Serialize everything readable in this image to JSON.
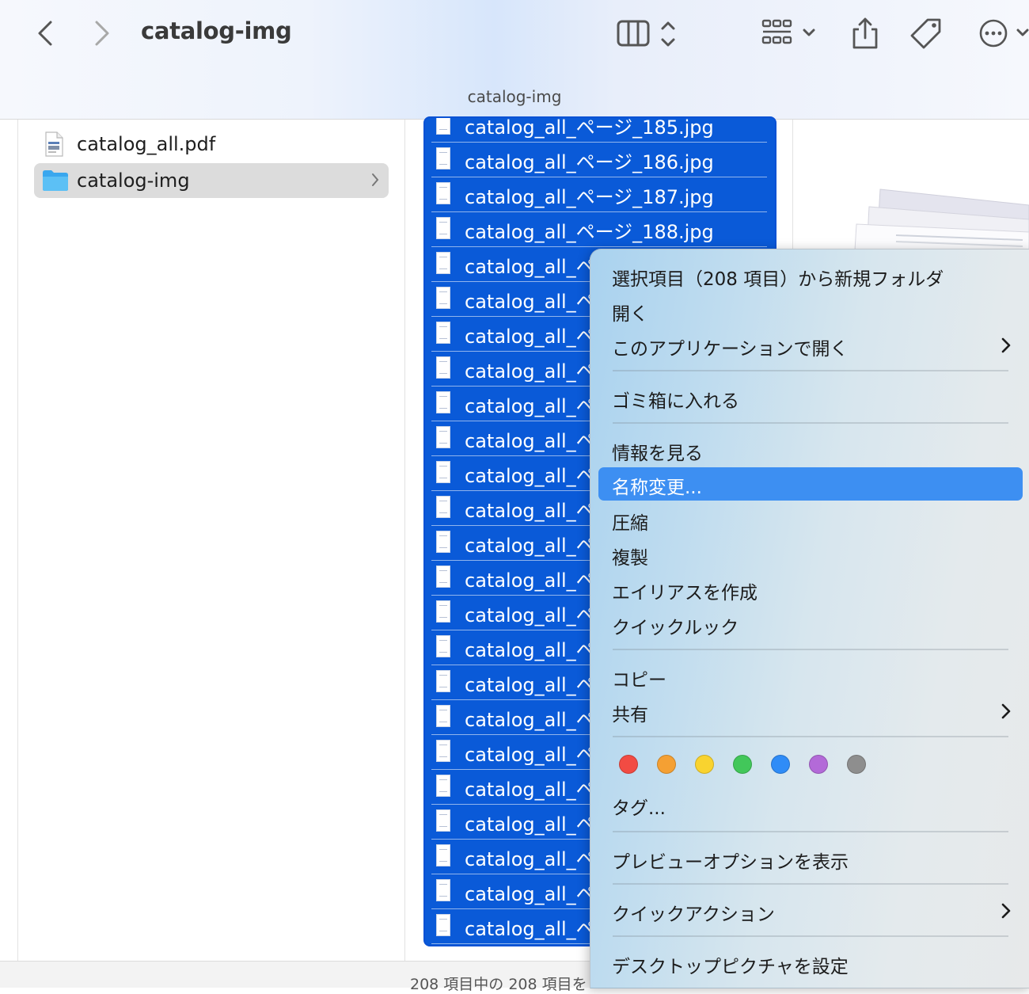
{
  "window": {
    "title": "catalog-img",
    "path_label": "catalog-img"
  },
  "toolbar": {
    "back_icon": "chevron-left-icon",
    "forward_icon": "chevron-right-icon",
    "view_icon": "column-view-icon",
    "group_icon": "grid-view-icon",
    "share_icon": "share-icon",
    "tag_icon": "tag-icon",
    "more_icon": "ellipsis-circle-icon"
  },
  "sidebar_column": {
    "items": [
      {
        "label": "catalog_all.pdf",
        "icon": "pdf-file-icon",
        "selected": false
      },
      {
        "label": "catalog-img",
        "icon": "folder-icon",
        "selected": true
      }
    ]
  },
  "file_column": {
    "files": [
      "catalog_all_ページ_185.jpg",
      "catalog_all_ページ_186.jpg",
      "catalog_all_ページ_187.jpg",
      "catalog_all_ページ_188.jpg",
      "catalog_all_ペ",
      "catalog_all_ペ",
      "catalog_all_ペ",
      "catalog_all_ペ",
      "catalog_all_ペ",
      "catalog_all_ペ",
      "catalog_all_ペ",
      "catalog_all_ペ",
      "catalog_all_ペ",
      "catalog_all_ペ",
      "catalog_all_ペ",
      "catalog_all_ペ",
      "catalog_all_ペ",
      "catalog_all_ペ",
      "catalog_all_ペ",
      "catalog_all_ペ",
      "catalog_all_ペ",
      "catalog_all_ペ",
      "catalog_all_ペ",
      "catalog_all_ペ"
    ]
  },
  "status": {
    "text": "208 項目中の 208 項目を"
  },
  "context_menu": {
    "new_folder": "選択項目（208 項目）から新規フォルダ",
    "open": "開く",
    "open_with": "このアプリケーションで開く",
    "trash": "ゴミ箱に入れる",
    "get_info": "情報を見る",
    "rename": "名称変更...",
    "compress": "圧縮",
    "duplicate": "複製",
    "make_alias": "エイリアスを作成",
    "quick_look": "クイックルック",
    "copy": "コピー",
    "share": "共有",
    "tags": "タグ...",
    "preview_options": "プレビューオプションを表示",
    "quick_actions": "クイックアクション",
    "set_desktop": "デスクトップピクチャを設定",
    "tag_colors": [
      "#f24b43",
      "#f5a033",
      "#f9d32f",
      "#42c75a",
      "#2f8cf7",
      "#b36ad8",
      "#8e8e8e"
    ],
    "highlight_color": "#3d8ff2"
  },
  "colors": {
    "selection_blue": "#0a5ad8",
    "folder_blue": "#4db6f2"
  }
}
